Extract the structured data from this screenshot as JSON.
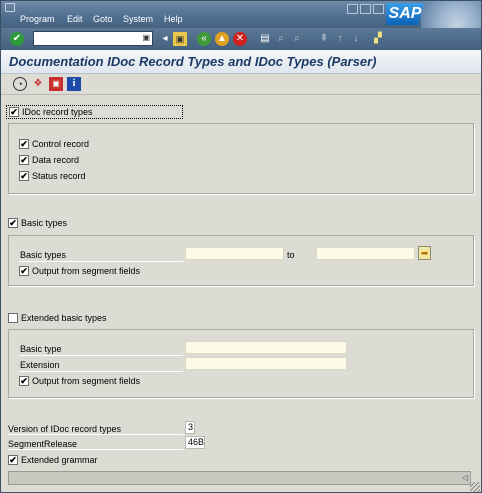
{
  "menubar": {
    "items": [
      "Program",
      "Edit",
      "Goto",
      "System",
      "Help"
    ],
    "logo": "SAP"
  },
  "toolbar": {
    "command_field": "",
    "icons": [
      "enter-icon",
      "save-icon",
      "back-icon",
      "exit-icon",
      "cancel-icon",
      "print-icon",
      "find-icon",
      "find-next-icon",
      "first-page-icon",
      "prev-page-icon",
      "next-page-icon",
      "new-session-icon"
    ]
  },
  "title": "Documentation IDoc Record Types and IDoc Types (Parser)",
  "app_toolbar": {
    "icons": [
      "execute-icon",
      "variant-icon",
      "save-variant-icon",
      "info-icon"
    ]
  },
  "sections": {
    "record_types": {
      "label": "IDoc record types",
      "checked": true,
      "items": [
        {
          "label": "Control record",
          "checked": true
        },
        {
          "label": "Data record",
          "checked": true
        },
        {
          "label": "Status record",
          "checked": true
        }
      ]
    },
    "basic_types": {
      "label": "Basic types",
      "checked": true,
      "field_label": "Basic types",
      "from_value": "",
      "to_label": "to",
      "to_value": "",
      "output_label": "Output from segment fields",
      "output_checked": true
    },
    "extended_types": {
      "label": "Extended basic types",
      "checked": false,
      "basic_type_label": "Basic type",
      "basic_type_value": "",
      "extension_label": "Extension",
      "extension_value": "",
      "output_label": "Output from segment fields",
      "output_checked": true
    }
  },
  "bottom": {
    "version_label": "Version of IDoc record types",
    "version_value": "3",
    "segment_label": "SegmentRelease",
    "segment_value": "46B",
    "grammar_label": "Extended grammar",
    "grammar_checked": true
  },
  "status": {
    "text": ""
  }
}
